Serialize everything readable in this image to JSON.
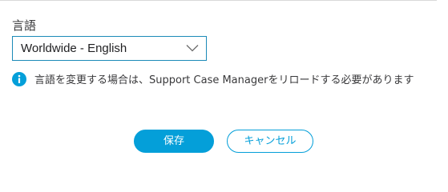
{
  "language_section": {
    "label": "言語",
    "selected_value": "Worldwide - English",
    "dropdown_icon": "chevron-down-icon"
  },
  "notice": {
    "icon": "info-icon",
    "text": "言語を変更する場合は、Support Case Managerをリロードする必要があります",
    "icon_color": "#049fd9"
  },
  "actions": {
    "save_label": "保存",
    "cancel_label": "キャンセル"
  },
  "colors": {
    "accent": "#049fd9",
    "select_border": "#1c8ab8"
  }
}
